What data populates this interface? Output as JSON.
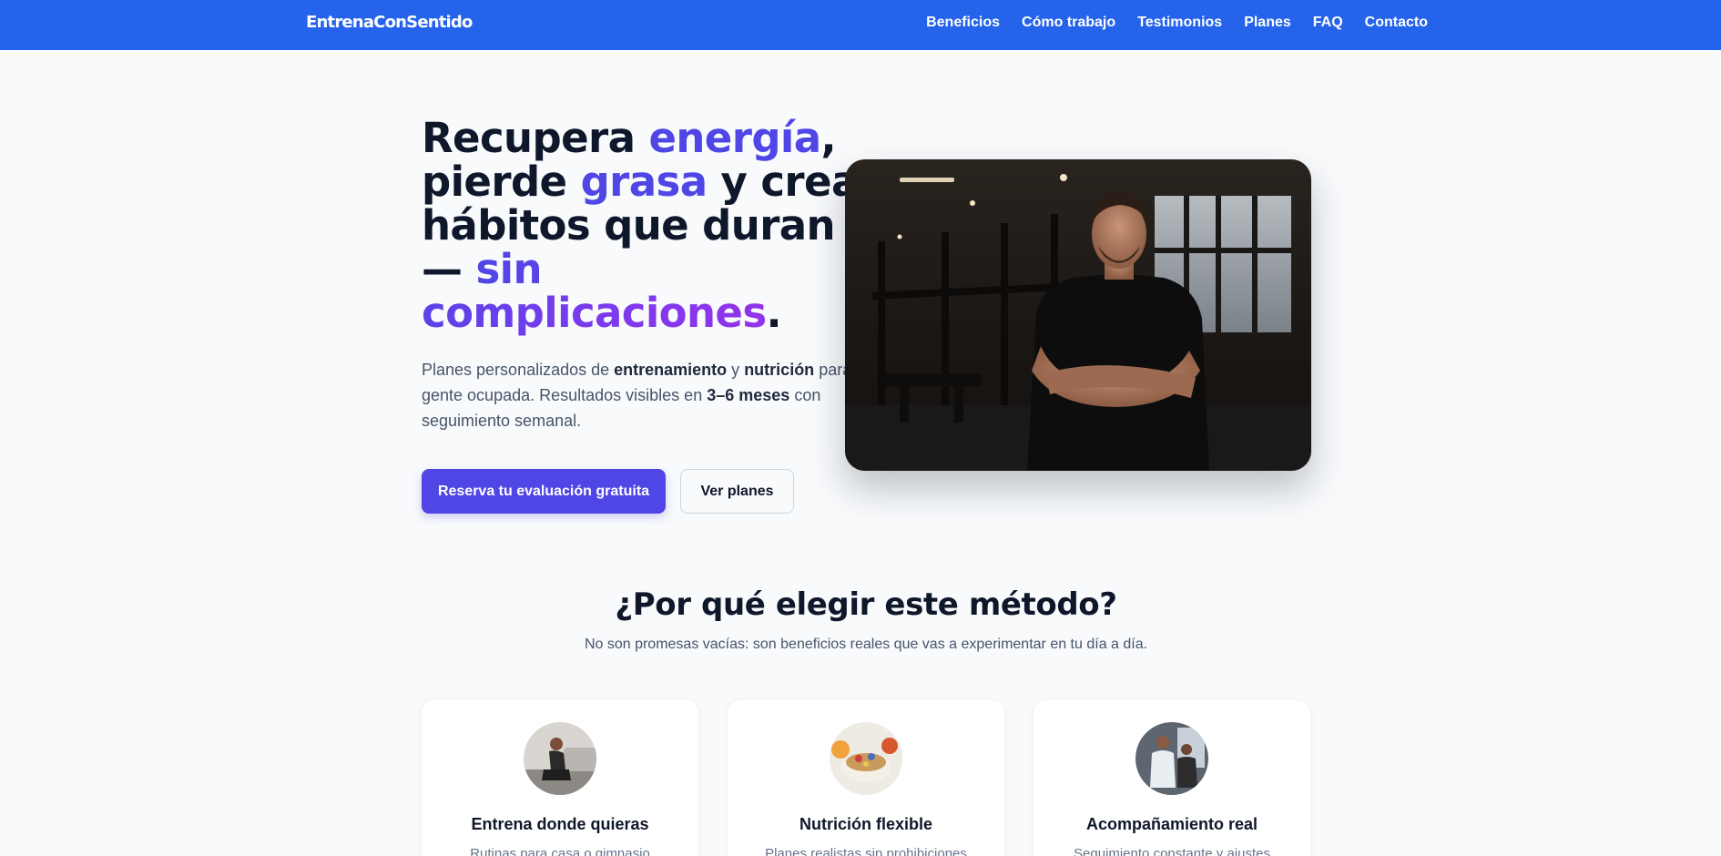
{
  "header": {
    "brand": "EntrenaConSentido",
    "nav": [
      "Beneficios",
      "Cómo trabajo",
      "Testimonios",
      "Planes",
      "FAQ",
      "Contacto"
    ]
  },
  "hero": {
    "title_parts": {
      "p1": "Recupera ",
      "p2": "energía",
      "p3": ", pierde ",
      "p4": "grasa",
      "p5": " y crea hábitos que duran — ",
      "p6": "sin complicaciones",
      "p7": "."
    },
    "subtitle_parts": {
      "s1": "Planes personalizados de ",
      "s2": "entrenamiento",
      "s3": " y ",
      "s4": "nutrición",
      "s5": " para gente ocupada. Resultados visibles en ",
      "s6": "3–6 meses",
      "s7": " con seguimiento semanal."
    },
    "primary_cta": "Reserva tu evaluación gratuita",
    "secondary_cta": "Ver planes"
  },
  "benefits": {
    "title": "¿Por qué elegir este método?",
    "subtitle": "No son promesas vacías: son beneficios reales que vas a experimentar en tu día a día.",
    "cards": [
      {
        "title": "Entrena donde quieras",
        "text": "Rutinas para casa o gimnasio"
      },
      {
        "title": "Nutrición flexible",
        "text": "Planes realistas sin prohibiciones"
      },
      {
        "title": "Acompañamiento real",
        "text": "Seguimiento constante y ajustes"
      }
    ]
  },
  "colors": {
    "header_bg": "#2563eb",
    "accent": "#4f46e5",
    "accent_purple": "#9333ea",
    "page_bg": "#f8fafc"
  }
}
